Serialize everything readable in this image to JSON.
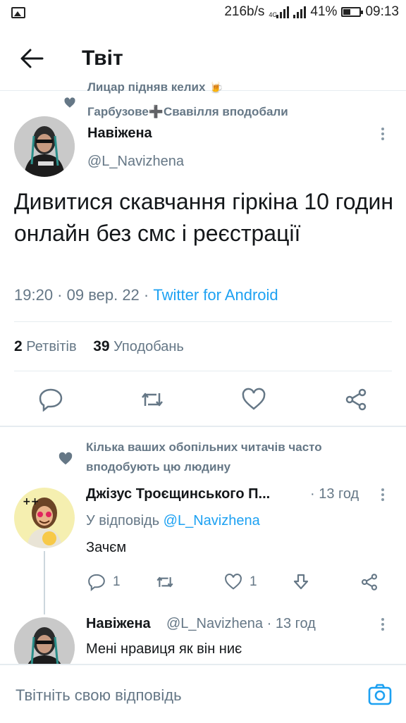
{
  "status_bar": {
    "speed": "216b/s",
    "network": "4G",
    "battery": "41%",
    "time": "09:13"
  },
  "header": {
    "title": "Твіт"
  },
  "main_tweet": {
    "context_line1": "Лицар підняв келих 🍺",
    "context_line2": "Гарбузове➕Свавілля вподобали",
    "name": "Навіжена",
    "handle": "@L_Navizhena",
    "text": "Дивитися скавчання гіркіна 10 годин онлайн без смс і реєстрації",
    "time": "19:20 · 09 вер. 22 · ",
    "source": "Twitter for Android",
    "retweets_count": "2",
    "retweets_label": "Ретвітів",
    "likes_count": "39",
    "likes_label": "Уподобань"
  },
  "social_context": {
    "text_line1": "Кілька ваших обопільних читачів часто",
    "text_line2": "вподобують цю людину"
  },
  "reply1": {
    "name": "Джізус Троєщинського П...",
    "time": "· 13 год",
    "replying_prefix": "У відповідь ",
    "replying_to": "@L_Navizhena",
    "text": "Зачєм",
    "reply_count": "1",
    "like_count": "1"
  },
  "reply2": {
    "name": "Навіжена",
    "handle_time": "@L_Navizhena · 13 год",
    "text": "Мені нравиця як він ниє"
  },
  "composer": {
    "placeholder": "Твітніть свою відповідь"
  },
  "colors": {
    "accent": "#1da1f2",
    "muted": "#657786",
    "divider": "#e6ecf0"
  }
}
